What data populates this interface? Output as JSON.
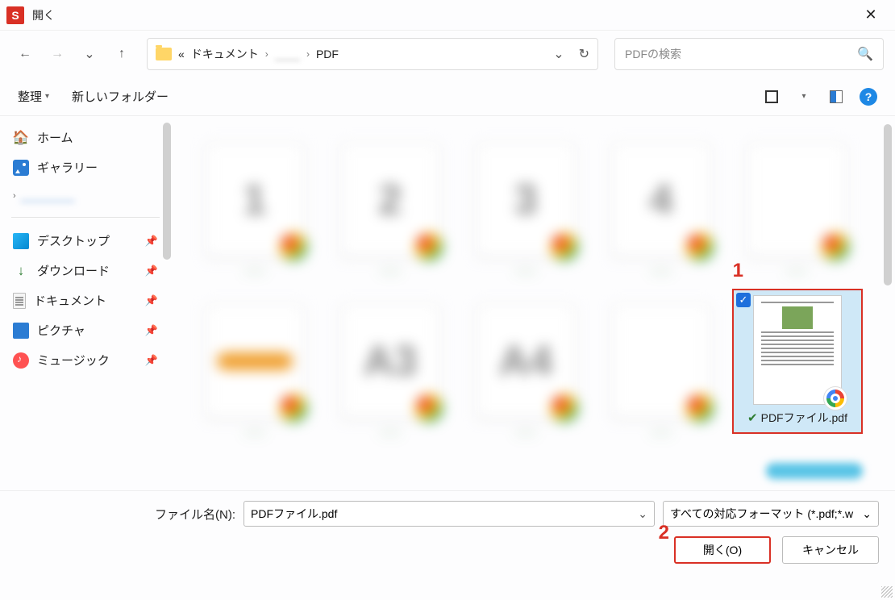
{
  "title": "開く",
  "breadcrumb": {
    "root_prefix": "«",
    "seg1": "ドキュメント",
    "seg2_blurred": "____",
    "seg3": "PDF"
  },
  "search": {
    "placeholder": "PDFの検索"
  },
  "toolbar": {
    "organize": "整理",
    "new_folder": "新しいフォルダー"
  },
  "sidebar": {
    "home": "ホーム",
    "gallery": "ギャラリー",
    "blurred_item": "________",
    "desktop": "デスクトップ",
    "downloads": "ダウンロード",
    "documents": "ドキュメント",
    "pictures": "ピクチャ",
    "music": "ミュージック"
  },
  "selected_file": {
    "name": "PDFファイル.pdf"
  },
  "annotations": {
    "one": "1",
    "two": "2"
  },
  "footer": {
    "filename_label": "ファイル名(N):",
    "filename_value": "PDFファイル.pdf",
    "filter": "すべての対応フォーマット (*.pdf;*.w",
    "open": "開く(O)",
    "cancel": "キャンセル"
  }
}
